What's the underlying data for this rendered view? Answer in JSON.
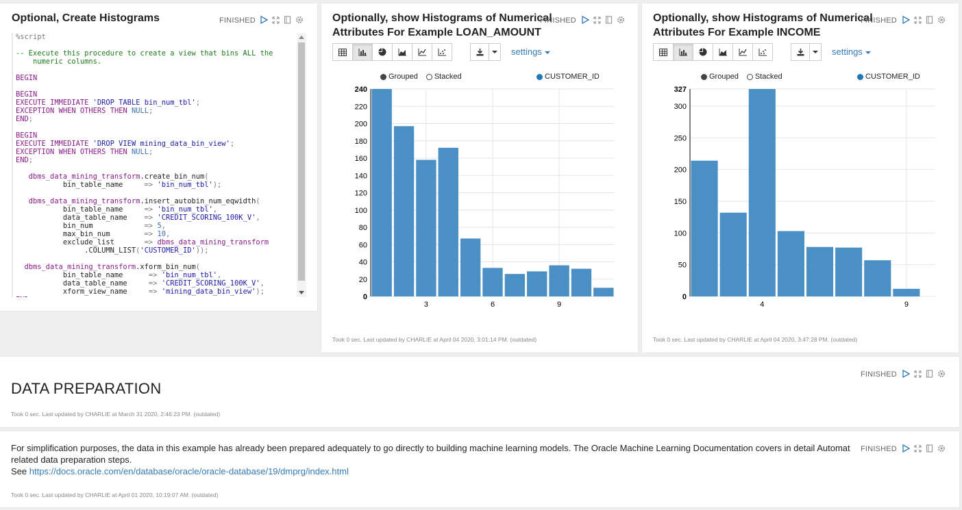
{
  "colors": {
    "bar": "#4a90c4",
    "accent": "#337ab7",
    "grid": "#e5e5e5"
  },
  "paragraph1": {
    "title": "Optional, Create Histograms",
    "status": "FINISHED",
    "icons": [
      "run-icon",
      "expand-icon",
      "book-icon",
      "gear-icon"
    ],
    "code_lines": [
      {
        "t": "%script",
        "c": "o"
      },
      {
        "t": "",
        "c": ""
      },
      {
        "t": "-- Execute this procedure to create a view that bins ALL the",
        "c": "c"
      },
      {
        "t": "    numeric columns.",
        "c": "c"
      },
      {
        "t": "",
        "c": ""
      },
      {
        "t": "BEGIN",
        "c": "k"
      },
      {
        "t": "",
        "c": ""
      },
      {
        "t": "BEGIN",
        "c": "k"
      },
      {
        "t": "EXECUTE IMMEDIATE 'DROP TABLE bin_num_tbl';",
        "c": "mix1"
      },
      {
        "t": "EXCEPTION WHEN OTHERS THEN NULL;",
        "c": "k"
      },
      {
        "t": "END;",
        "c": "k"
      },
      {
        "t": "",
        "c": ""
      },
      {
        "t": "BEGIN",
        "c": "k"
      },
      {
        "t": "EXECUTE IMMEDIATE 'DROP VIEW mining_data_bin_view';",
        "c": "mix1"
      },
      {
        "t": "EXCEPTION WHEN OTHERS THEN NULL;",
        "c": "k"
      },
      {
        "t": "END;",
        "c": "k"
      },
      {
        "t": "",
        "c": ""
      },
      {
        "t": "   dbms_data_mining_transform.create_bin_num(",
        "c": ""
      },
      {
        "t": "           bin_table_name     => 'bin_num_tbl');",
        "c": ""
      },
      {
        "t": "",
        "c": ""
      },
      {
        "t": "   dbms_data_mining_transform.insert_autobin_num_eqwidth(",
        "c": ""
      },
      {
        "t": "           bin_table_name     => 'bin_num_tbl',",
        "c": ""
      },
      {
        "t": "           data_table_name    => 'CREDIT_SCORING_100K_V',",
        "c": ""
      },
      {
        "t": "           bin_num            => 5,",
        "c": ""
      },
      {
        "t": "           max_bin_num        => 10,",
        "c": ""
      },
      {
        "t": "           exclude_list       => dbms_data_mining_transform",
        "c": ""
      },
      {
        "t": "                .COLUMN_LIST('CUSTOMER_ID'));",
        "c": ""
      },
      {
        "t": "",
        "c": ""
      },
      {
        "t": "  dbms_data_mining_transform.xform_bin_num(",
        "c": ""
      },
      {
        "t": "           bin_table_name      => 'bin_num_tbl',",
        "c": ""
      },
      {
        "t": "           data_table_name     => 'CREDIT_SCORING_100K_V',",
        "c": ""
      },
      {
        "t": "           xform_view_name     => 'mining_data_bin_view');",
        "c": ""
      },
      {
        "t": "END;",
        "c": "k"
      }
    ]
  },
  "paragraph2": {
    "title_line1": "Optionally, show Histograms of Numerical",
    "title_line2": "Attributes For Example LOAN_AMOUNT",
    "status": "FINISHED",
    "settings_label": "settings",
    "legend": {
      "grouped": "Grouped",
      "stacked": "Stacked",
      "series": "CUSTOMER_ID"
    },
    "footer": "Took 0 sec. Last updated by CHARLIE at April 04 2020, 3:01:14 PM. (outdated)"
  },
  "paragraph3": {
    "title_line1": "Optionally, show Histograms of Numerical",
    "title_line2": "Attributes For Example INCOME",
    "status": "FINISHED",
    "settings_label": "settings",
    "legend": {
      "grouped": "Grouped",
      "stacked": "Stacked",
      "series": "CUSTOMER_ID"
    },
    "footer": "Took 0 sec. Last updated by CHARLIE at April 04 2020, 3:47:28 PM. (outdated)"
  },
  "paragraph4": {
    "title": "DATA PREPARATION",
    "status": "FINISHED",
    "footer": "Took 0 sec. Last updated by CHARLIE at March 31 2020, 2:46:23 PM. (outdated)"
  },
  "paragraph5": {
    "text_line1": "For simplification purposes, the data in this example has already been prepared adequately to go directly to building machine learning models. The Oracle Machine Learning Documentation covers in detail Automat",
    "text_line2": "related data preparation steps.",
    "see_label": "See ",
    "link": "https://docs.oracle.com/en/database/oracle/oracle-database/19/dmprg/index.html",
    "status": "FINISHED",
    "footer": "Took 0 sec. Last updated by CHARLIE at April 01 2020, 10:19:07 AM. (outdated)"
  },
  "chart_data": [
    {
      "type": "bar",
      "title": "",
      "series": [
        {
          "name": "CUSTOMER_ID",
          "values": [
            240,
            197,
            158,
            172,
            67,
            33,
            26,
            29,
            36,
            32,
            10
          ]
        }
      ],
      "categories": [
        1,
        2,
        3,
        4,
        5,
        6,
        7,
        8,
        9,
        10,
        11
      ],
      "xticks": [
        3,
        6,
        9
      ],
      "ylim": [
        0,
        240
      ],
      "yticks": [
        0,
        20,
        40,
        60,
        80,
        100,
        120,
        140,
        160,
        180,
        200,
        220,
        240
      ],
      "grid": true,
      "legend": "top"
    },
    {
      "type": "bar",
      "title": "",
      "series": [
        {
          "name": "CUSTOMER_ID",
          "values": [
            214,
            132,
            327,
            103,
            78,
            77,
            57,
            12
          ]
        }
      ],
      "categories": [
        2,
        3,
        4,
        5,
        6,
        7,
        8,
        9
      ],
      "xticks": [
        4,
        9
      ],
      "ylim": [
        0,
        327
      ],
      "yticks": [
        0,
        50,
        100,
        150,
        200,
        250,
        300,
        327
      ],
      "grid": true,
      "legend": "top"
    }
  ]
}
